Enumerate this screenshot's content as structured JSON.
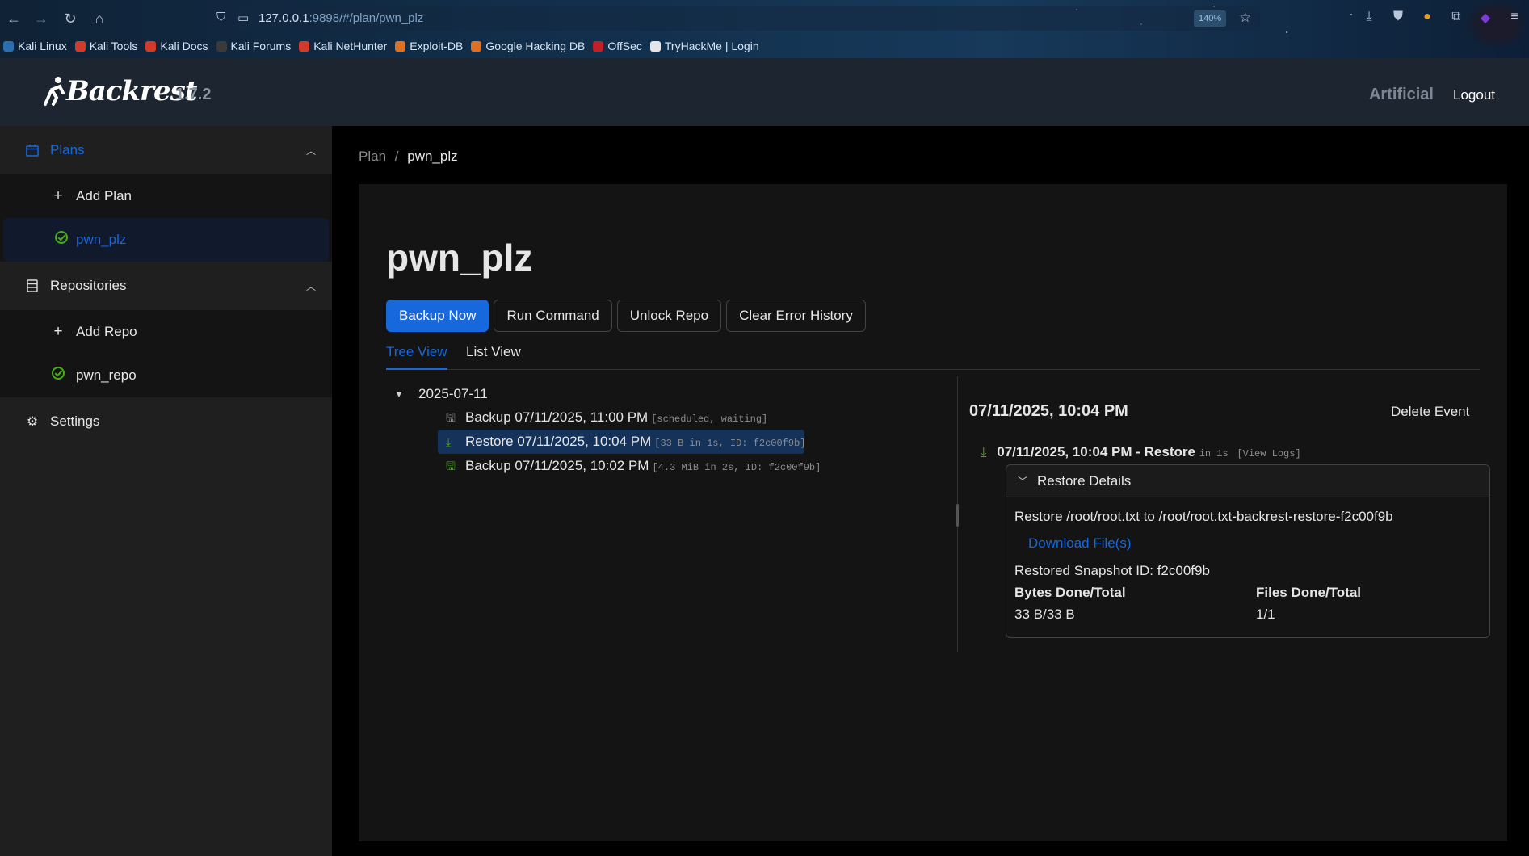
{
  "browser": {
    "url_host": "127.0.0.1",
    "url_rest": ":9898/#/plan/pwn_plz",
    "zoom": "140%",
    "bookmarks": [
      {
        "label": "Kali Linux",
        "color": "#2c6fb0"
      },
      {
        "label": "Kali Tools",
        "color": "#d23b2a"
      },
      {
        "label": "Kali Docs",
        "color": "#d23b2a"
      },
      {
        "label": "Kali Forums",
        "color": "#3a3a3a"
      },
      {
        "label": "Kali NetHunter",
        "color": "#d23b2a"
      },
      {
        "label": "Exploit-DB",
        "color": "#e0701f"
      },
      {
        "label": "Google Hacking DB",
        "color": "#e0701f"
      },
      {
        "label": "OffSec",
        "color": "#c0202a"
      },
      {
        "label": "TryHackMe | Login",
        "color": "#e6e6e6"
      }
    ]
  },
  "header": {
    "logo": "Backrest",
    "version": "1.7.2",
    "instance": "Artificial",
    "logout": "Logout"
  },
  "sidebar": {
    "plans_label": "Plans",
    "add_plan": "Add Plan",
    "plan_item": "pwn_plz",
    "repos_label": "Repositories",
    "add_repo": "Add Repo",
    "repo_item": "pwn_repo",
    "settings": "Settings"
  },
  "main": {
    "breadcrumb": {
      "root": "Plan",
      "sep": "/",
      "current": "pwn_plz"
    },
    "title": "pwn_plz",
    "buttons": {
      "backup_now": "Backup Now",
      "run_command": "Run Command",
      "unlock_repo": "Unlock Repo",
      "clear_error": "Clear Error History"
    },
    "tabs": {
      "tree": "Tree View",
      "list": "List View"
    },
    "tree": {
      "date": "2025-07-11",
      "events": [
        {
          "label": "Backup 07/11/2025, 11:00 PM",
          "meta": "[scheduled, waiting]"
        },
        {
          "label": "Restore 07/11/2025, 10:04 PM",
          "meta": "[33 B in 1s, ID: f2c00f9b]"
        },
        {
          "label": "Backup 07/11/2025, 10:02 PM",
          "meta": "[4.3 MiB in 2s, ID: f2c00f9b]"
        }
      ]
    },
    "detail": {
      "title": "07/11/2025, 10:04 PM",
      "delete": "Delete Event",
      "op_title": "07/11/2025, 10:04 PM - Restore",
      "op_duration": "in 1s",
      "op_logs": "[View Logs]",
      "panel_title": "Restore Details",
      "restore_text": "Restore /root/root.txt to /root/root.txt-backrest-restore-f2c00f9b",
      "download": "Download File(s)",
      "snapshot": "Restored Snapshot ID: f2c00f9b",
      "bytes_label": "Bytes Done/Total",
      "bytes_value": "33 B/33 B",
      "files_label": "Files Done/Total",
      "files_value": "1/1"
    }
  }
}
